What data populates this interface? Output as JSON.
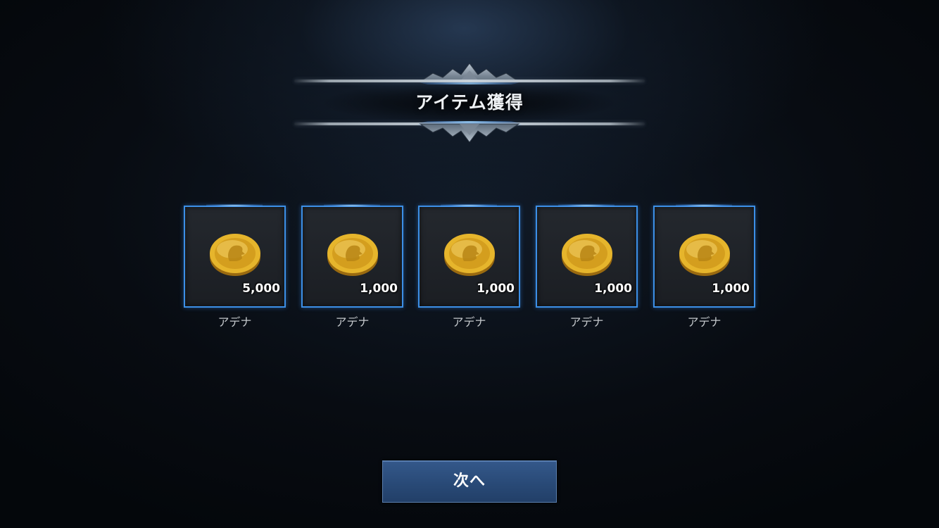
{
  "dialog": {
    "title": "アイテム獲得"
  },
  "rewards": [
    {
      "name": "アデナ",
      "quantity": "5,000",
      "icon": "gold-coin-icon"
    },
    {
      "name": "アデナ",
      "quantity": "1,000",
      "icon": "gold-coin-icon"
    },
    {
      "name": "アデナ",
      "quantity": "1,000",
      "icon": "gold-coin-icon"
    },
    {
      "name": "アデナ",
      "quantity": "1,000",
      "icon": "gold-coin-icon"
    },
    {
      "name": "アデナ",
      "quantity": "1,000",
      "icon": "gold-coin-icon"
    }
  ],
  "buttons": {
    "next_label": "次へ"
  },
  "colors": {
    "slot_border": "#3c8fe6",
    "button": "#2c4f80",
    "coin_gold": "#e6b52c"
  }
}
